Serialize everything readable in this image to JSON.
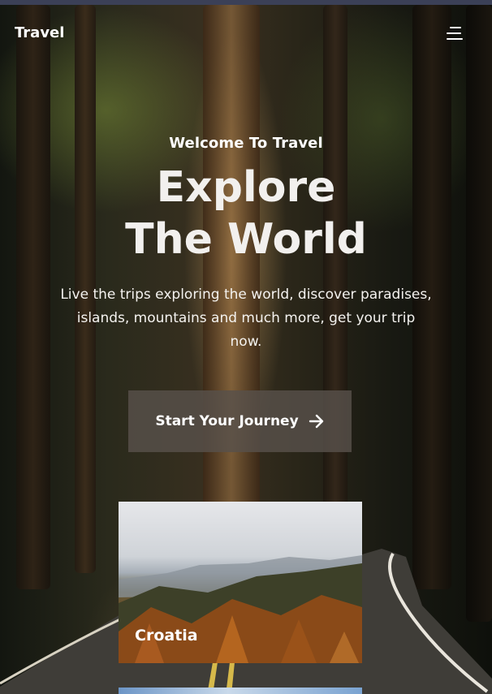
{
  "nav": {
    "logo": "Travel",
    "menu_icon": "hamburger-menu-icon"
  },
  "hero": {
    "welcome": "Welcome To Travel",
    "headline_line1": "Explore",
    "headline_line2": "The World",
    "description": "Live the trips exploring the world, discover paradises, islands, mountains and much more, get your trip now.",
    "cta_label": "Start Your Journey",
    "cta_icon": "arrow-right-icon"
  },
  "destinations": [
    {
      "name": "Croatia"
    }
  ],
  "colors": {
    "text": "#ffffff",
    "cta_background": "#58504a"
  }
}
